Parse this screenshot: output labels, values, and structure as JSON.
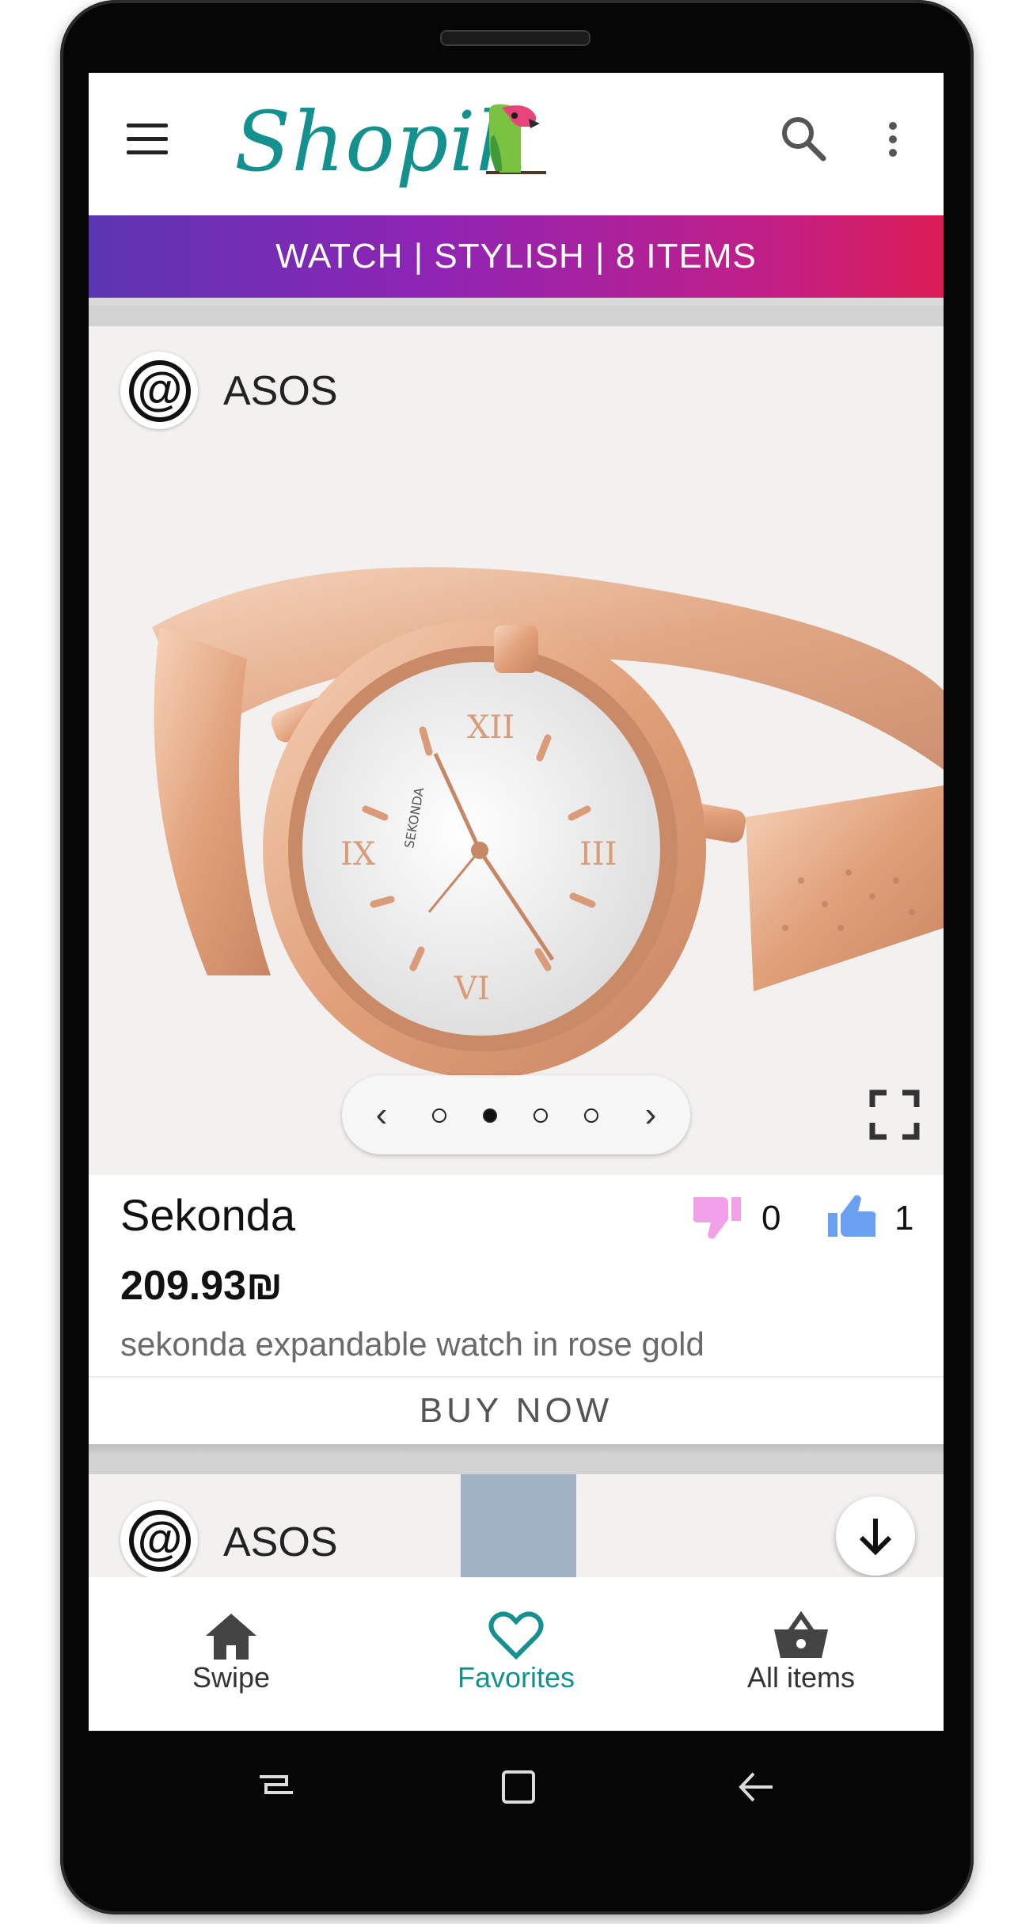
{
  "app": {
    "logo_text": "Shopik"
  },
  "banner": {
    "text": "WATCH | STYLISH | 8 ITEMS"
  },
  "cards": [
    {
      "store_logo_glyph": "@",
      "store_name": "ASOS",
      "title": "Sekonda",
      "price": "209.93₪",
      "description": "sekonda expandable watch in rose gold",
      "dislikes": "0",
      "likes": "1",
      "buy_label": "BUY NOW",
      "carousel": {
        "prev": "‹",
        "next": "›",
        "dot_count": 4,
        "active_dot": 2
      }
    },
    {
      "store_logo_glyph": "@",
      "store_name": "ASOS"
    }
  ],
  "bottom_nav": [
    {
      "label": "Swipe",
      "icon": "home-icon",
      "active": false
    },
    {
      "label": "Favorites",
      "icon": "heart-icon",
      "active": true
    },
    {
      "label": "All items",
      "icon": "basket-icon",
      "active": false
    }
  ],
  "colors": {
    "brand_teal": "#14908e",
    "banner_start": "#5b35b2",
    "banner_end": "#dc1c55",
    "dislike_pink": "#f2a0e8",
    "like_blue": "#6a9ff2"
  }
}
